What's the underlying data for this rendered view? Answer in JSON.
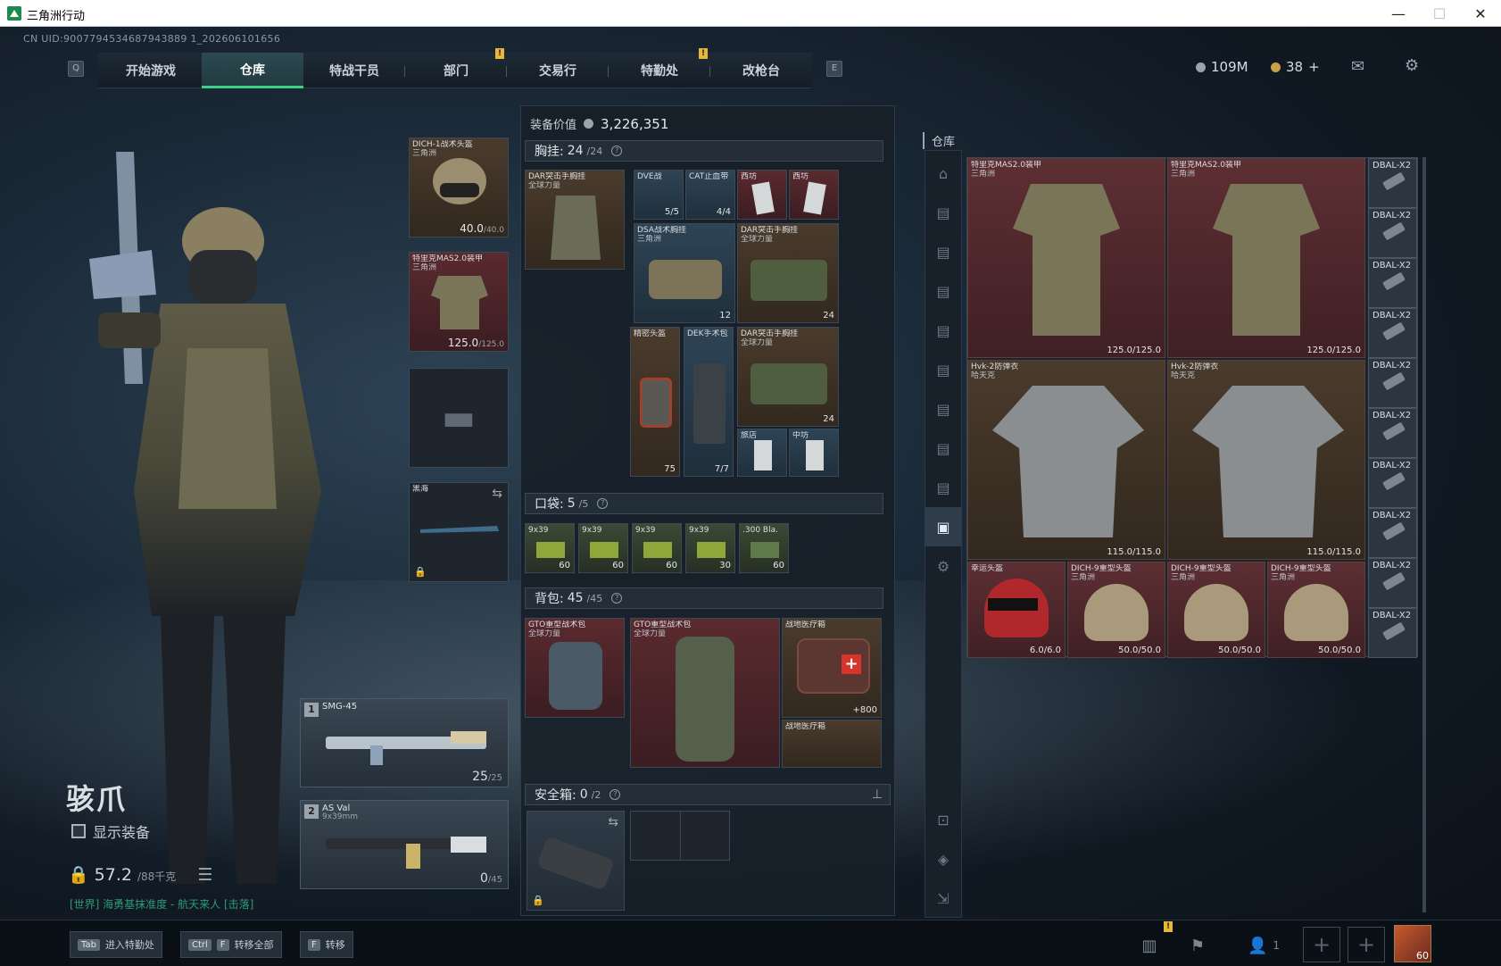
{
  "window": {
    "title": "三角洲行动",
    "min": "—",
    "max": "☐",
    "close": "✕"
  },
  "uid": "CN UID:9007794534687943889 1_202606101656",
  "nav": {
    "key_left": "Q",
    "key_right": "E",
    "tabs": [
      "开始游戏",
      "仓库",
      "特战干员",
      "部门",
      "交易行",
      "特勤处",
      "改枪台"
    ],
    "active_index": 1
  },
  "currency": {
    "money": "109M",
    "coins": "38",
    "plus": "+"
  },
  "character": {
    "name": "骇爪",
    "show_equipment": "显示装备",
    "weight": "57.2",
    "weight_max": "/88千克",
    "chat": "[世界] 海勇基抹准度 - 航天来人 [击落]"
  },
  "equip": {
    "helmet": {
      "name": "DICH-1战术头盔",
      "sub": "三角洲",
      "value": "40.0",
      "max": "/40.0"
    },
    "armor": {
      "name": "特里克MAS2.0装甲",
      "sub": "三角洲",
      "value": "125.0",
      "max": "/125.0"
    },
    "melee": {
      "name": "黑海"
    }
  },
  "weapons": [
    {
      "slot": "1",
      "name": "SMG-45",
      "sub": "",
      "ammo": "25",
      "max": "/25"
    },
    {
      "slot": "2",
      "name": "AS Val",
      "sub": "9x39mm",
      "ammo": "0",
      "max": "/45"
    }
  ],
  "mid": {
    "equip_value_label": "装备价值",
    "equip_value": "3,226,351",
    "chest": {
      "label": "胸挂:",
      "count": "24",
      "max": "/24"
    },
    "chest_rig": {
      "name": "DAR突击手胸挂",
      "sub": "全球力量"
    },
    "chest_items": [
      {
        "name": "DVE战",
        "val": "5/5"
      },
      {
        "name": "CAT止血带",
        "val": "4/4"
      },
      {
        "name": "西坊",
        "val": ""
      },
      {
        "name": "西坊",
        "val": ""
      },
      {
        "name": "DSA战术胸挂",
        "sub": "三角洲",
        "val": "12"
      },
      {
        "name": "DAR突击手胸挂",
        "sub": "全球力量",
        "val": "24"
      },
      {
        "name": "精密头盔",
        "val": "75"
      },
      {
        "name": "DEK手术包",
        "val": "7/7"
      },
      {
        "name": "DAR突击手胸挂",
        "sub": "全球力量",
        "val": "24"
      },
      {
        "name": "旅店",
        "val": ""
      },
      {
        "name": "中坊",
        "val": ""
      }
    ],
    "pocket": {
      "label": "口袋:",
      "count": "5",
      "max": "/5"
    },
    "pocket_items": [
      {
        "name": "9x39",
        "val": "60"
      },
      {
        "name": "9x39",
        "val": "60"
      },
      {
        "name": "9x39",
        "val": "60"
      },
      {
        "name": "9x39",
        "val": "30"
      },
      {
        "name": ".300 Bla.",
        "val": "60"
      }
    ],
    "backpack": {
      "label": "背包:",
      "count": "45",
      "max": "/45"
    },
    "backpack_items": [
      {
        "name": "GTO重型战术包",
        "sub": "全球力量"
      },
      {
        "name": "GTO重型战术包",
        "sub": "全球力量"
      },
      {
        "name": "战地医疗箱",
        "val": "+800"
      },
      {
        "name": "战地医疗箱"
      }
    ],
    "safebox": {
      "label": "安全箱:",
      "count": "0",
      "max": "/2"
    }
  },
  "warehouse": {
    "title": "仓库",
    "items": [
      {
        "name": "特里克MAS2.0装甲",
        "sub": "三角洲",
        "val": "125.0/125.0"
      },
      {
        "name": "特里克MAS2.0装甲",
        "sub": "三角洲",
        "val": "125.0/125.0"
      },
      {
        "name": "Hvk-2防弹衣",
        "sub": "哈夫克",
        "val": "115.0/115.0"
      },
      {
        "name": "Hvk-2防弹衣",
        "sub": "哈夫克",
        "val": "115.0/115.0"
      },
      {
        "name": "幸运头盔",
        "val": "6.0/6.0"
      },
      {
        "name": "DICH-9重型头盔",
        "sub": "三角洲",
        "val": "50.0/50.0"
      },
      {
        "name": "DICH-9重型头盔",
        "sub": "三角洲",
        "val": "50.0/50.0"
      },
      {
        "name": "DICH-9重型头盔",
        "sub": "三角洲",
        "val": "50.0/50.0"
      }
    ],
    "dbal": [
      "DBAL-X2",
      "DBAL-X2",
      "DBAL-X2",
      "DBAL-X2",
      "DBAL-X2",
      "DBAL-X2",
      "DBAL-X2",
      "DBAL-X2",
      "DBAL-X2",
      "DBAL-X2"
    ]
  },
  "bottom": {
    "btn1_key": "Tab",
    "btn1_label": "进入特勤处",
    "btn2_key1": "Ctrl",
    "btn2_key2": "F",
    "btn2_label": "转移全部",
    "btn3_key": "F",
    "btn3_label": "转移",
    "friends": "1",
    "level": "60"
  }
}
